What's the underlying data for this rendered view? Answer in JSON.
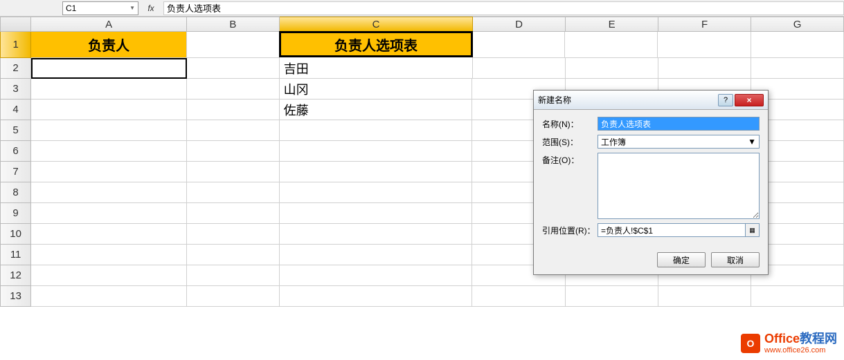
{
  "formula_bar": {
    "name_box": "C1",
    "fx_label": "fx",
    "formula": "负责人选项表"
  },
  "columns": [
    "A",
    "B",
    "C",
    "D",
    "E",
    "F",
    "G"
  ],
  "rows": [
    "1",
    "2",
    "3",
    "4",
    "5",
    "6",
    "7",
    "8",
    "9",
    "10",
    "11",
    "12",
    "13"
  ],
  "active_cell": "C1",
  "cells": {
    "A1": "负责人",
    "C1": "负责人选项表",
    "C2": "吉田",
    "C3": "山冈",
    "C4": "佐藤"
  },
  "dialog": {
    "title": "新建名称",
    "help": "?",
    "close": "×",
    "name_label": "名称(N)：",
    "name_value": "负责人选项表",
    "scope_label": "范围(S)：",
    "scope_value": "工作簿",
    "comment_label": "备注(O)：",
    "refers_label": "引用位置(R)：",
    "refers_value": "=负责人!$C$1",
    "ok": "确定",
    "cancel": "取消"
  },
  "watermark": {
    "icon": "O",
    "title1": "Office",
    "title2": "教程网",
    "url": "www.office26.com"
  }
}
